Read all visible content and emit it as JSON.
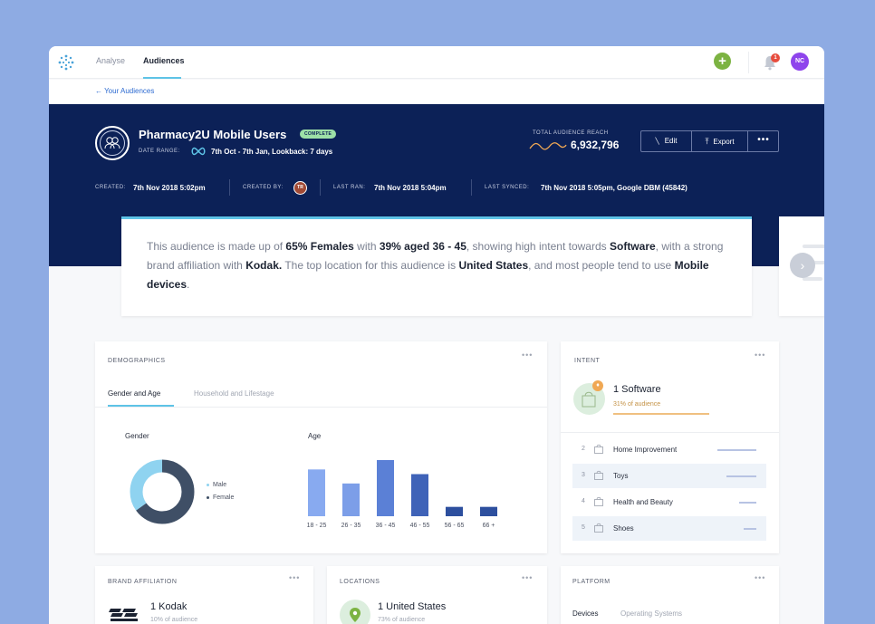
{
  "nav": {
    "tabs": [
      "Analyse",
      "Audiences"
    ],
    "notification_count": "1",
    "user_initials": "NC"
  },
  "breadcrumb": {
    "back_label": "← Your Audiences"
  },
  "audience": {
    "name": "Pharmacy2U Mobile Users",
    "status": "COMPLETE",
    "date_range_label": "DATE RANGE:",
    "date_range_value": "7th Oct - 7th Jan, Lookback: 7 days",
    "reach_label": "TOTAL AUDIENCE REACH",
    "reach_value": "6,932,796",
    "created_label": "CREATED:",
    "created_value": "7th Nov 2018 5:02pm",
    "created_by_label": "CREATED BY:",
    "created_by_initials": "TR",
    "last_ran_label": "LAST RAN:",
    "last_ran_value": "7th Nov 2018 5:04pm",
    "last_synced_label": "LAST SYNCED:",
    "last_synced_value": "7th Nov 2018 5:05pm, Google DBM (45842)"
  },
  "actions": {
    "edit": "Edit",
    "export": "Export",
    "more": "•••"
  },
  "summary": {
    "p1": "This audience is made up of ",
    "b1": "65% Females",
    "p2": " with ",
    "b2": "39% aged 36 - 45",
    "p3": ", showing high intent towards ",
    "b3": "Software",
    "p4": ", with a strong brand affiliation with ",
    "b4": "Kodak.",
    "p5": " The top location for this audience is ",
    "b5": "United States",
    "p6": ", and most people tend to use ",
    "b6": "Mobile devices",
    "p7": "."
  },
  "demographics": {
    "title": "DEMOGRAPHICS",
    "tabs": [
      "Gender and Age",
      "Household and Lifestage"
    ],
    "gender_label": "Gender",
    "age_label": "Age",
    "gender_legend": [
      "Male",
      "Female"
    ]
  },
  "chart_data": [
    {
      "type": "pie",
      "categories": [
        "Male",
        "Female"
      ],
      "values": [
        35,
        65
      ],
      "colors": [
        "#8fd3f0",
        "#3f4f66"
      ],
      "title": "Gender"
    },
    {
      "type": "bar",
      "categories": [
        "18 - 25",
        "26 - 35",
        "36 - 45",
        "46 - 55",
        "56 - 65",
        "66 +"
      ],
      "values": [
        30,
        21,
        36,
        27,
        6,
        6
      ],
      "colors": [
        "#88aaf0",
        "#7c9ee8",
        "#5b80d6",
        "#3f63b8",
        "#2d4f9e",
        "#2d4f9e"
      ],
      "title": "Age"
    }
  ],
  "intent": {
    "title": "INTENT",
    "top": {
      "name": "1 Software",
      "share": "31% of audience"
    },
    "items": [
      {
        "rank": "2",
        "name": "Home Improvement",
        "bar": 0.6
      },
      {
        "rank": "3",
        "name": "Toys",
        "bar": 0.46
      },
      {
        "rank": "4",
        "name": "Health and Beauty",
        "bar": 0.26
      },
      {
        "rank": "5",
        "name": "Shoes",
        "bar": 0.2
      }
    ]
  },
  "brand": {
    "title": "BRAND AFFILIATION",
    "top": "1 Kodak",
    "share": "10% of audience"
  },
  "locations": {
    "title": "LOCATIONS",
    "top": "1 United States",
    "share": "73% of audience"
  },
  "platform": {
    "title": "PLATFORM",
    "tabs": [
      "Devices",
      "Operating Systems"
    ]
  },
  "colors": {
    "accent": "#5ec3e6",
    "hero": "#0c2157",
    "add": "#7cb342"
  }
}
